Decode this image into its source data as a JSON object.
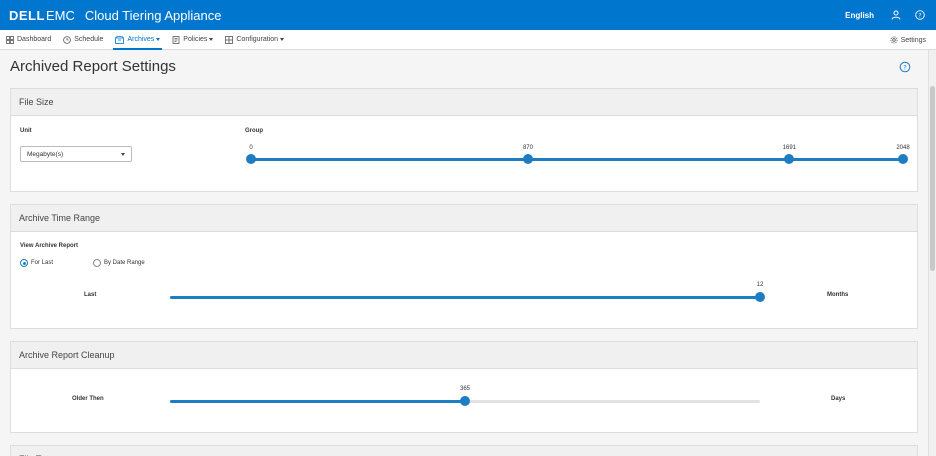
{
  "header": {
    "logo_text": "DELL",
    "logo_suffix": "EMC",
    "app_title": "Cloud Tiering Appliance",
    "language": "English",
    "user_icon": "user-icon",
    "help_icon": "help-icon",
    "brand_color": "#0076ce"
  },
  "nav": {
    "items": [
      {
        "label": "Dashboard",
        "icon": "dashboard-icon"
      },
      {
        "label": "Schedule",
        "icon": "clock-icon"
      },
      {
        "label": "Archives",
        "icon": "archive-icon",
        "active": true
      },
      {
        "label": "Policies",
        "icon": "policy-icon"
      },
      {
        "label": "Configuration",
        "icon": "grid-icon"
      }
    ],
    "settings_label": "Settings"
  },
  "page": {
    "title": "Archived Report Settings"
  },
  "file_size": {
    "header": "File Size",
    "unit_label": "Unit",
    "unit_value": "Megabyte(s)",
    "group_label": "Group",
    "slider_min": 0,
    "slider_max": 2048,
    "points": [
      "0",
      "870",
      "1691",
      "2048"
    ],
    "point_values": [
      0,
      870,
      1691,
      2048
    ]
  },
  "archive_time_range": {
    "header": "Archive Time Range",
    "view_label": "View Archive Report",
    "radio_for_last": "For Last",
    "radio_by_date_range": "By Date Range",
    "selected": "For Last",
    "last_label": "Last",
    "value": "12",
    "value_num": 12,
    "max": 12,
    "unit": "Months"
  },
  "archive_report_cleanup": {
    "header": "Archive Report Cleanup",
    "older_label": "Older Then",
    "value": "365",
    "value_num": 365,
    "max": 730,
    "unit": "Days"
  },
  "file_type": {
    "header": "File Type"
  }
}
